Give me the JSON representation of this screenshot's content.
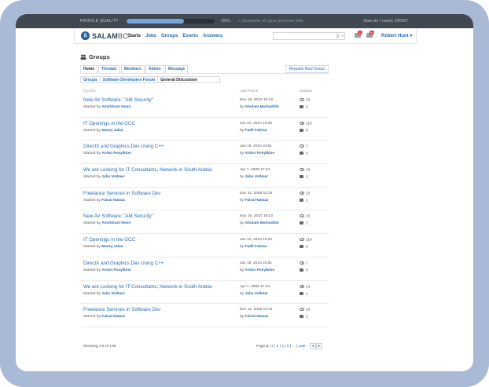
{
  "topbar": {
    "profile_quality_label": "PROFILE QUALITY",
    "progress_percent": 65,
    "progress_text": "65%",
    "complete_text": "» Complete all your personal info",
    "how_link": "How do I reach 100%?"
  },
  "navbar": {
    "logo_mark": "S",
    "logo_bold": "SALAM",
    "logo_light": "BC",
    "links": [
      "Starts",
      "Jobs",
      "Groups",
      "Events",
      "Answers"
    ],
    "search_placeholder": "",
    "messages_badge": "12",
    "notifications_badge": "99",
    "user_name": "Robert Hunt ▾"
  },
  "page": {
    "title": "Groups",
    "tabs": [
      "Home",
      "Threads",
      "Members",
      "Admin",
      "Message"
    ],
    "request_button": "Request New Group",
    "breadcrumb": [
      "Groups",
      "Software Developers Forum",
      "General Discussion"
    ]
  },
  "table": {
    "headers": {
      "forums": "Forums",
      "last_post": "Last Post ▾",
      "statistic": "Statistic"
    },
    "rows": [
      {
        "title": "New AV Software: \"AM Security\"",
        "started_prefix": "Started by ",
        "started_by": "Amirkhoni Nosir",
        "date": "Nov 16, 2010 18:23",
        "last_prefix": "by ",
        "last_by": "Ghulam Muhiuddin",
        "views": "23",
        "replies": "2"
      },
      {
        "title": "IT Openings in the GCC",
        "started_prefix": "Started by ",
        "started_by": "Manoj Jalan",
        "date": "Jan 24, 2010 19:26",
        "last_prefix": "by ",
        "last_by": "Fadil Fatima",
        "views": "119",
        "replies": "6"
      },
      {
        "title": "DirectX and Graphics Dev Using C++",
        "started_prefix": "Started by ",
        "started_by": "Anton Posylkine",
        "date": "Jan 19, 2010 23:51",
        "last_prefix": "by ",
        "last_by": "Anton Posylkine",
        "views": "7",
        "replies": "0"
      },
      {
        "title": "We are Looking for IT Consultants, Network in South Arabia",
        "started_prefix": "Started by ",
        "started_by": "Julia Vollmer",
        "date": "Apr 7, 2008 17:24",
        "last_prefix": "by ",
        "last_by": "Julia Vollmer",
        "views": "23",
        "replies": "2"
      },
      {
        "title": "Freelance Services in Software Dev",
        "started_prefix": "Started by ",
        "started_by": "Faisal Nawaz",
        "date": "Dec 11, 2008 10:24",
        "last_prefix": "by ",
        "last_by": "Faisal Nawaz",
        "views": "23",
        "replies": "2"
      },
      {
        "title": "New AV Software: \"AM Security\"",
        "started_prefix": "Started by ",
        "started_by": "Amirkhoni Nosir",
        "date": "Nov 16, 2010 18:23",
        "last_prefix": "by ",
        "last_by": "Ghulam Muhiuddin",
        "views": "23",
        "replies": "2"
      },
      {
        "title": "IT Openings in the GCC",
        "started_prefix": "Started by ",
        "started_by": "Manoj Jalan",
        "date": "Jan 24, 2010 19:26",
        "last_prefix": "by ",
        "last_by": "Fadil Fatima",
        "views": "119",
        "replies": "6"
      },
      {
        "title": "DirectX and Graphics Dev Using C++",
        "started_prefix": "Started by ",
        "started_by": "Anton Posylkine",
        "date": "Jan 19, 2010 23:51",
        "last_prefix": "by ",
        "last_by": "Anton Posylkine",
        "views": "7",
        "replies": "0"
      },
      {
        "title": "We are Looking for IT Consultants, Network in South Arabia",
        "started_prefix": "Started by ",
        "started_by": "Julia Vollmer",
        "date": "Apr 7, 2008 17:24",
        "last_prefix": "by ",
        "last_by": "Julia Vollmer",
        "views": "23",
        "replies": "2"
      },
      {
        "title": "Freelance Services in Software Dev",
        "started_prefix": "Started by ",
        "started_by": "Faisal Nawaz",
        "date": "Dec 11, 2008 10:24",
        "last_prefix": "by ",
        "last_by": "Faisal Nawaz",
        "views": "23",
        "replies": "2"
      }
    ]
  },
  "footer": {
    "showing": "Showing 1-5 of 136",
    "page_label": "Page ",
    "current_page": "1",
    "pages": [
      "2",
      "3",
      "4",
      "5"
    ],
    "ellipsis": "...",
    "last": "Last",
    "prev": "◂",
    "next": "▸"
  },
  "colors": {
    "frame": "#a8bad6",
    "topbar": "#414850",
    "link": "#2a6cb0",
    "progress": "#6fa8dc"
  },
  "icons": [
    "users-icon",
    "search-icon",
    "messages-icon",
    "notifications-icon",
    "eye-icon",
    "comment-icon"
  ]
}
